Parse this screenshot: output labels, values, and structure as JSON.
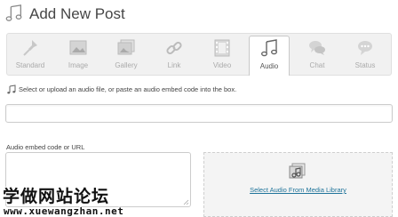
{
  "header": {
    "title": "Add New Post",
    "icon": "music-note-icon"
  },
  "formats": [
    {
      "label": "Standard",
      "icon": "pin-icon",
      "active": false
    },
    {
      "label": "Image",
      "icon": "image-icon",
      "active": false
    },
    {
      "label": "Gallery",
      "icon": "gallery-icon",
      "active": false
    },
    {
      "label": "Link",
      "icon": "link-icon",
      "active": false
    },
    {
      "label": "Video",
      "icon": "film-icon",
      "active": false
    },
    {
      "label": "Audio",
      "icon": "music-note-icon",
      "active": true
    },
    {
      "label": "Chat",
      "icon": "chat-bubbles-icon",
      "active": false
    },
    {
      "label": "Status",
      "icon": "status-bubble-icon",
      "active": false
    }
  ],
  "instructions": "Select or upload an audio file, or paste an audio embed code into the box.",
  "url_input": {
    "value": "",
    "placeholder": ""
  },
  "embed": {
    "label": "Audio embed code or URL",
    "value": ""
  },
  "media": {
    "link_label": "Select Audio From Media Library",
    "icon": "media-audio-icon"
  },
  "watermark": {
    "title": "学做网站论坛",
    "url": "www.xuewangzhan.net"
  },
  "colors": {
    "link": "#21759b",
    "bar_bg": "#f1f1f1",
    "active_tab_bg": "#ffffff"
  }
}
